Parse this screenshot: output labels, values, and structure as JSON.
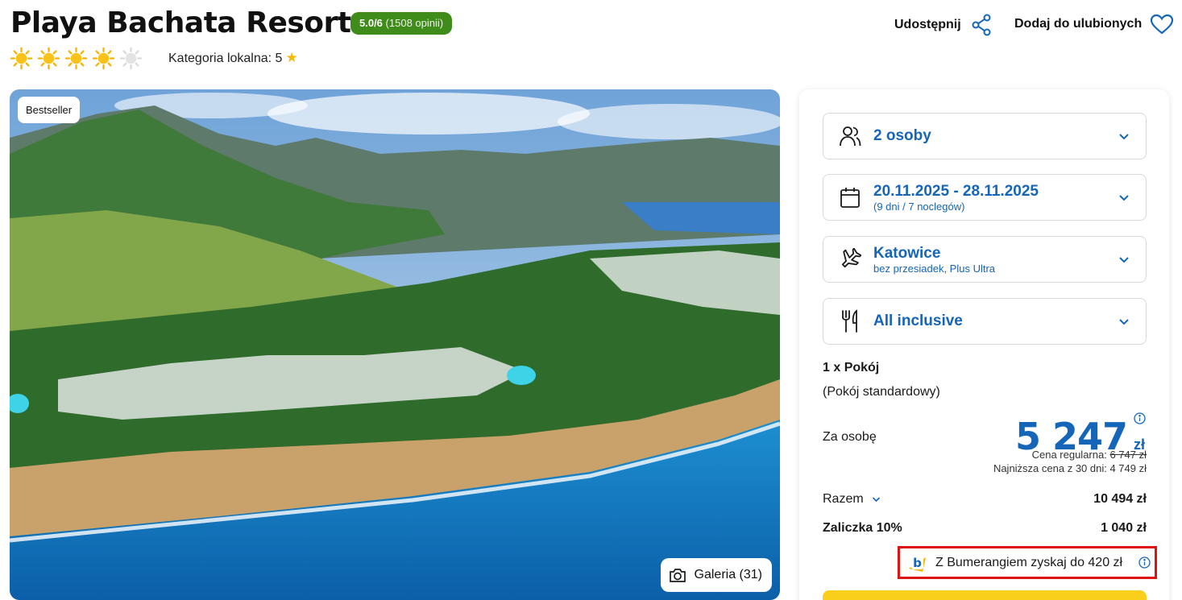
{
  "hotel": {
    "name": "Playa Bachata Resort",
    "rating_score": "5.0/6",
    "rating_opinions": "(1508 opinii)",
    "stars_filled": 4,
    "stars_total": 5,
    "local_category_label": "Kategoria lokalna: 5"
  },
  "actions": {
    "share_label": "Udostępnij",
    "favorite_label": "Dodaj do ulubionych"
  },
  "gallery": {
    "badge": "Bestseller",
    "button_label": "Galeria (31)"
  },
  "booking": {
    "travellers": {
      "value": "2 osoby",
      "icon": "people-icon"
    },
    "dates": {
      "value": "20.11.2025 - 28.11.2025",
      "sub": "(9 dni / 7 noclegów)",
      "icon": "calendar-icon"
    },
    "departure": {
      "value": "Katowice",
      "sub": "bez przesiadek, Plus Ultra",
      "icon": "plane-icon"
    },
    "board": {
      "value": "All inclusive",
      "icon": "fork-knife-icon"
    },
    "room_count": "1 x Pokój",
    "room_type": "(Pokój standardowy)",
    "per_person_label": "Za osobę",
    "price": "5 247",
    "currency": "zł",
    "regular_price_label": "Cena regularna:",
    "regular_price": "6 747 zł",
    "lowest_price_text": "Najniższa cena z 30 dni: 4 749 zł",
    "total_label": "Razem",
    "total_value": "10 494 zł",
    "deposit_label": "Zaliczka 10%",
    "deposit_value": "1 040 zł",
    "bumerang_text": "Z Bumerangiem zyskaj do 420 zł"
  },
  "colors": {
    "accent_blue": "#1565b8",
    "rating_green": "#3f8c1a",
    "cta_yellow": "#f9cf1c",
    "highlight_red": "#e01313"
  }
}
